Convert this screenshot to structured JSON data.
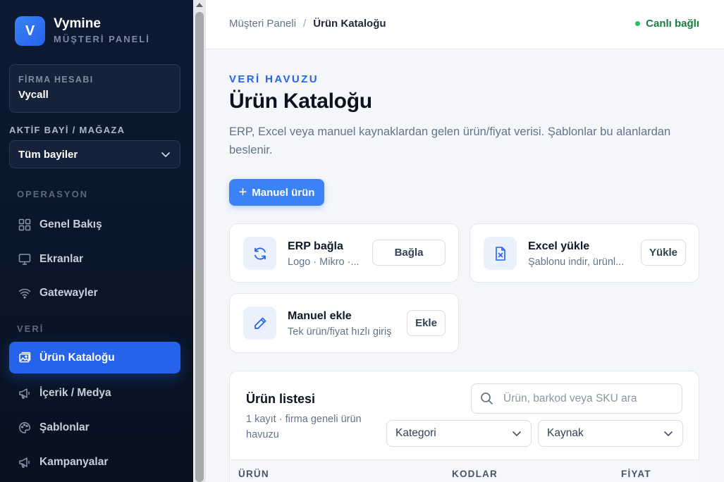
{
  "brand": {
    "logo_letter": "V",
    "name": "Vymine",
    "subtitle": "MÜŞTERİ PANELİ"
  },
  "company": {
    "label": "FİRMA HESABI",
    "name": "Vycall"
  },
  "dealer": {
    "label": "AKTİF BAYİ / MAĞAZA",
    "selected": "Tüm bayiler"
  },
  "sidebar": {
    "sections": [
      {
        "label": "OPERASYON"
      },
      {
        "label": "VERİ"
      }
    ],
    "items": [
      {
        "label": "Genel Bakış",
        "icon": "grid-icon"
      },
      {
        "label": "Ekranlar",
        "icon": "monitor-icon"
      },
      {
        "label": "Gatewayler",
        "icon": "wifi-icon"
      },
      {
        "label": "Ürün Kataloğu",
        "icon": "image-icon",
        "active": true
      },
      {
        "label": "İçerik / Medya",
        "icon": "megaphone-icon"
      },
      {
        "label": "Şablonlar",
        "icon": "palette-icon"
      },
      {
        "label": "Kampanyalar",
        "icon": "megaphone-icon"
      }
    ]
  },
  "topbar": {
    "breadcrumb": {
      "parent": "Müşteri Paneli",
      "separator": "/",
      "current": "Ürün Kataloğu"
    },
    "status": {
      "label": "Canlı bağlı",
      "color": "#22c55e"
    }
  },
  "page": {
    "eyebrow": "VERİ HAVUZU",
    "title": "Ürün Kataloğu",
    "description": "ERP, Excel veya manuel kaynaklardan gelen ürün/fiyat verisi. Şablonlar bu alanlardan beslenir.",
    "primary_button": "Manuel ürün"
  },
  "sources": [
    {
      "title": "ERP bağla",
      "subtitle": "Logo · Mikro ·...",
      "button": "Bağla",
      "icon": "refresh-icon"
    },
    {
      "title": "Excel yükle",
      "subtitle": "Şablonu indir, ürünl...",
      "button": "Yükle",
      "icon": "excel-file-icon"
    },
    {
      "title": "Manuel ekle",
      "subtitle": "Tek ürün/fiyat hızlı giriş",
      "button": "Ekle",
      "icon": "pencil-icon"
    }
  ],
  "product_list": {
    "title": "Ürün listesi",
    "subtitle": "1 kayıt · firma geneli ürün havuzu",
    "search_placeholder": "Ürün, barkod veya SKU ara",
    "filters": [
      "Kategori",
      "Kaynak"
    ],
    "columns": [
      "ÜRÜN",
      "KODLAR",
      "FİYAT"
    ]
  },
  "colors": {
    "accent": "#3b82f6",
    "sidebar_bg": "#0c1a33",
    "live": "#15803d"
  }
}
